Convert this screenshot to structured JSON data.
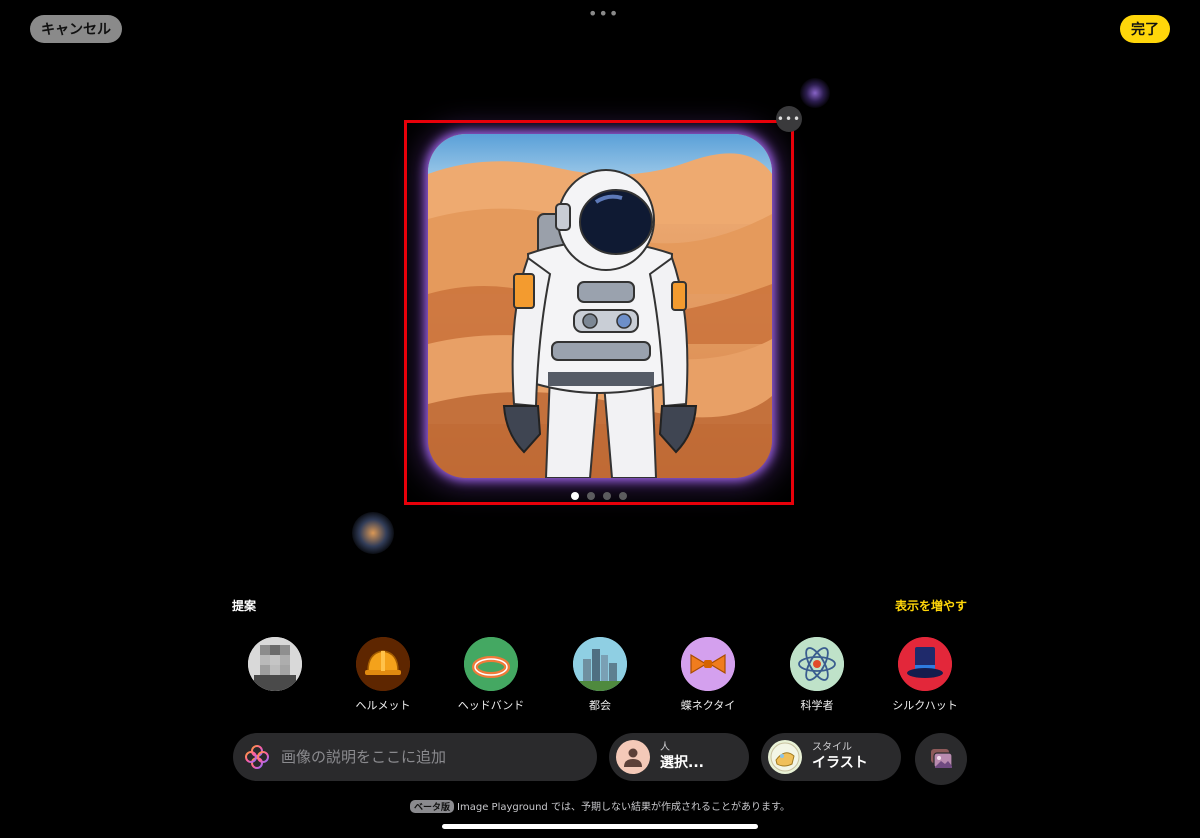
{
  "header": {
    "cancel_label": "キャンセル",
    "done_label": "完了",
    "handle_glyph": "•••"
  },
  "canvas": {
    "more_glyph": "•••",
    "page_count": 4,
    "current_page": 1,
    "glow_color": "#a36bff",
    "selection_color": "#e8000a"
  },
  "suggestions": {
    "title": "提案",
    "show_more": "表示を増やす",
    "items": [
      {
        "label": "",
        "icon": "person-avatar"
      },
      {
        "label": "ヘルメット",
        "icon": "helmet-icon"
      },
      {
        "label": "ヘッドバンド",
        "icon": "headband-icon"
      },
      {
        "label": "都会",
        "icon": "city-icon"
      },
      {
        "label": "蝶ネクタイ",
        "icon": "bow-tie-icon"
      },
      {
        "label": "科学者",
        "icon": "atom-icon"
      },
      {
        "label": "シルクハット",
        "icon": "top-hat-icon"
      }
    ]
  },
  "bottom_bar": {
    "prompt_placeholder": "画像の説明をここに追加",
    "person_caption": "人",
    "person_value": "選択...",
    "style_caption": "スタイル",
    "style_value": "イラスト"
  },
  "footer": {
    "beta_badge": "ベータ版",
    "note": "Image Playground では、予期しない結果が作成されることがあります。"
  },
  "colors": {
    "accent_yellow": "#ffd60a",
    "background": "#000000",
    "control_gray": "#2a2a2c"
  }
}
